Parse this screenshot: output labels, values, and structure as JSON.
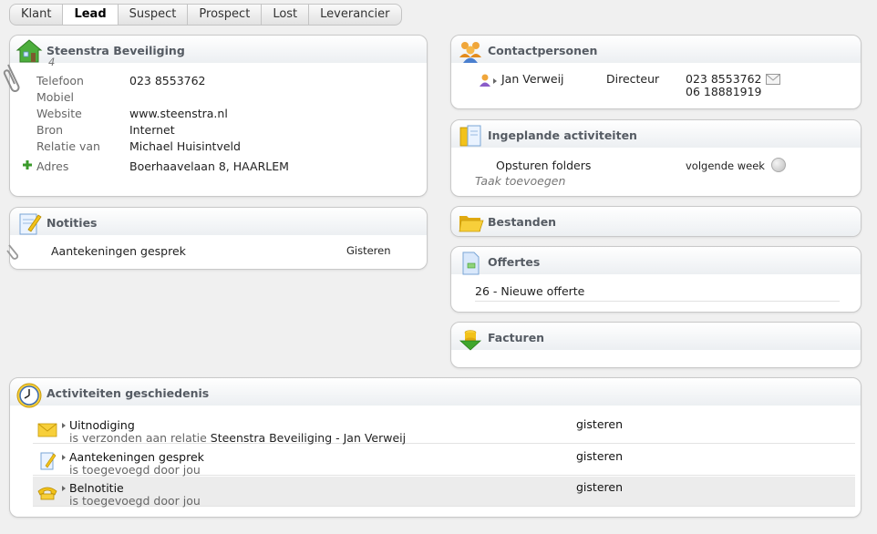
{
  "tabs": [
    {
      "label": "Klant"
    },
    {
      "label": "Lead"
    },
    {
      "label": "Suspect"
    },
    {
      "label": "Prospect"
    },
    {
      "label": "Lost"
    },
    {
      "label": "Leverancier"
    }
  ],
  "active_tab": "Lead",
  "company": {
    "title": "Steenstra Beveiliging",
    "number": "4",
    "fields": [
      {
        "label": "Telefoon",
        "value": "023 8553762"
      },
      {
        "label": "Mobiel",
        "value": ""
      },
      {
        "label": "Website",
        "value": "www.steenstra.nl"
      },
      {
        "label": "Bron",
        "value": "Internet"
      },
      {
        "label": "Relatie van",
        "value": "Michael Huisintveld"
      }
    ],
    "address": {
      "label": "Adres",
      "value": "Boerhaavelaan 8, HAARLEM"
    }
  },
  "notes": {
    "title": "Notities",
    "items": [
      {
        "text": "Aantekeningen gesprek",
        "when": "Gisteren"
      }
    ]
  },
  "contacts": {
    "title": "Contactpersonen",
    "items": [
      {
        "name": "Jan Verweij",
        "role": "Directeur",
        "phone": "023 8553762",
        "mobile": "06 18881919"
      }
    ]
  },
  "planned": {
    "title": "Ingeplande activiteiten",
    "items": [
      {
        "text": "Opsturen folders",
        "when": "volgende week"
      }
    ],
    "add_label": "Taak toevoegen"
  },
  "files": {
    "title": "Bestanden"
  },
  "quotes": {
    "title": "Offertes",
    "items": [
      {
        "text": "26 - Nieuwe offerte"
      }
    ]
  },
  "invoices": {
    "title": "Facturen"
  },
  "history": {
    "title": "Activiteiten geschiedenis",
    "items": [
      {
        "title": "Uitnodiging",
        "sub_prefix": "is verzonden aan relatie ",
        "sub_strong": "Steenstra Beveiliging - Jan Verweij",
        "when": "gisteren",
        "icon": "envelope-icon"
      },
      {
        "title": "Aantekeningen gesprek",
        "sub_prefix": "is toegevoegd door jou",
        "sub_strong": "",
        "when": "gisteren",
        "icon": "note-pencil-icon"
      },
      {
        "title": "Belnotitie",
        "sub_prefix": "is toegevoegd door jou",
        "sub_strong": "",
        "when": "gisteren",
        "icon": "phone-note-icon"
      }
    ]
  },
  "colors": {
    "panel_title": "#555b63",
    "accent_green": "#3a9a2a",
    "folder_yellow": "#f2c21a"
  }
}
